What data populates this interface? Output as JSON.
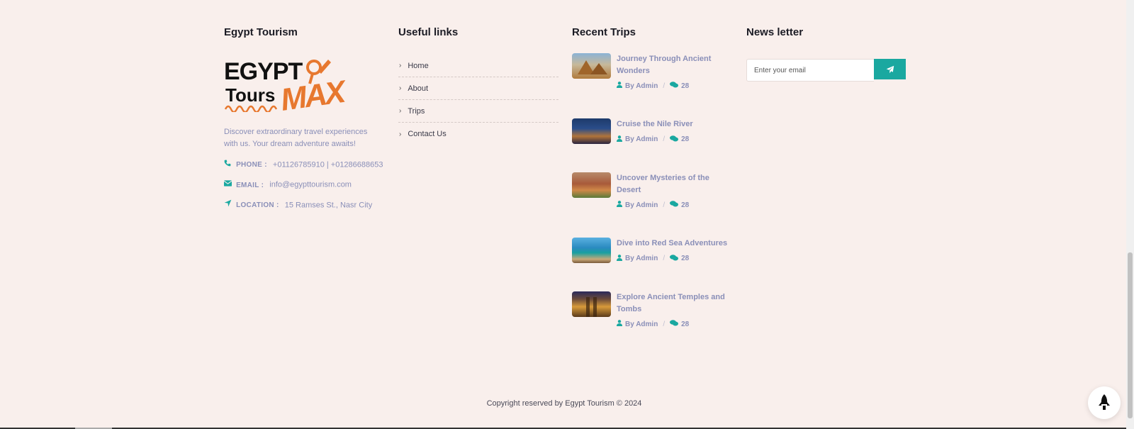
{
  "columns": {
    "about": {
      "title": "Egypt Tourism",
      "logo": {
        "line1": "EGYPT",
        "line2": "Tours",
        "line3": "MAX"
      },
      "description": "Discover extraordinary travel experiences with us. Your dream adventure awaits!",
      "phone": {
        "label": "PHONE :",
        "value": "+01126785910 | +01286688653"
      },
      "email": {
        "label": "EMAIL :",
        "value": "info@egypttourism.com"
      },
      "location": {
        "label": "LOCATION :",
        "value": "15 Ramses St., Nasr City"
      }
    },
    "links": {
      "title": "Useful links",
      "items": [
        {
          "label": "Home"
        },
        {
          "label": "About"
        },
        {
          "label": "Trips"
        },
        {
          "label": "Contact Us"
        }
      ]
    },
    "trips": {
      "title": "Recent Trips",
      "items": [
        {
          "title": "Journey Through Ancient Wonders",
          "author": "By Admin",
          "comments": "28"
        },
        {
          "title": "Cruise the Nile River",
          "author": "By Admin",
          "comments": "28"
        },
        {
          "title": "Uncover Mysteries of the Desert",
          "author": "By Admin",
          "comments": "28"
        },
        {
          "title": "Dive into Red Sea Adventures",
          "author": "By Admin",
          "comments": "28"
        },
        {
          "title": "Explore Ancient Temples and Tombs",
          "author": "By Admin",
          "comments": "28"
        }
      ]
    },
    "newsletter": {
      "title": "News letter",
      "placeholder": "Enter your email"
    }
  },
  "copyright": "Copyright reserved by Egypt Tourism © 2024",
  "colors": {
    "background": "#f9efec",
    "accent": "#1aa8a0",
    "muted_text": "#8a8fb8",
    "logo_orange": "#e7782f"
  },
  "icons": {
    "phone": "phone-icon",
    "email": "envelope-icon",
    "location": "location-arrow-icon",
    "link": "chevron-right-icon",
    "author": "user-icon",
    "comments": "comments-icon",
    "submit": "paper-plane-icon",
    "fab": "rocket-icon"
  }
}
